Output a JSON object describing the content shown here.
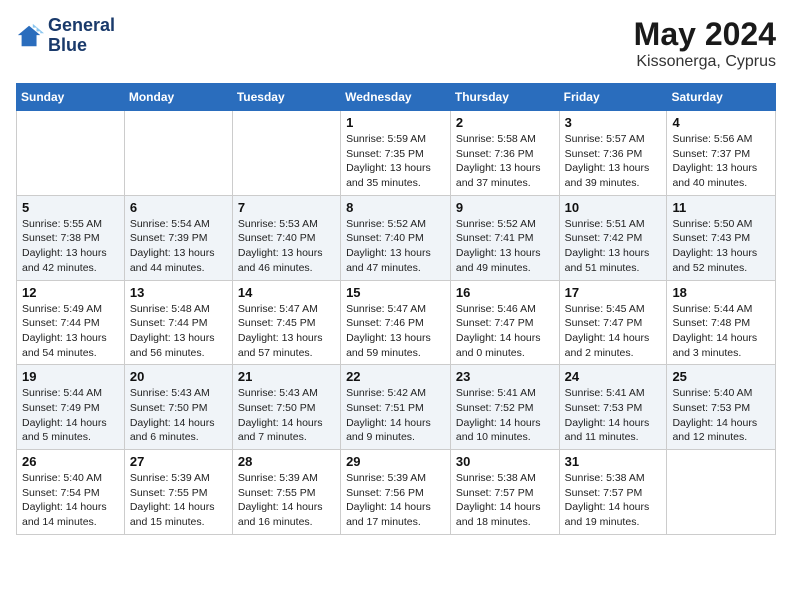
{
  "header": {
    "logo_line1": "General",
    "logo_line2": "Blue",
    "month_year": "May 2024",
    "location": "Kissonerga, Cyprus"
  },
  "weekdays": [
    "Sunday",
    "Monday",
    "Tuesday",
    "Wednesday",
    "Thursday",
    "Friday",
    "Saturday"
  ],
  "weeks": [
    [
      {
        "day": "",
        "info": ""
      },
      {
        "day": "",
        "info": ""
      },
      {
        "day": "",
        "info": ""
      },
      {
        "day": "1",
        "info": "Sunrise: 5:59 AM\nSunset: 7:35 PM\nDaylight: 13 hours\nand 35 minutes."
      },
      {
        "day": "2",
        "info": "Sunrise: 5:58 AM\nSunset: 7:36 PM\nDaylight: 13 hours\nand 37 minutes."
      },
      {
        "day": "3",
        "info": "Sunrise: 5:57 AM\nSunset: 7:36 PM\nDaylight: 13 hours\nand 39 minutes."
      },
      {
        "day": "4",
        "info": "Sunrise: 5:56 AM\nSunset: 7:37 PM\nDaylight: 13 hours\nand 40 minutes."
      }
    ],
    [
      {
        "day": "5",
        "info": "Sunrise: 5:55 AM\nSunset: 7:38 PM\nDaylight: 13 hours\nand 42 minutes."
      },
      {
        "day": "6",
        "info": "Sunrise: 5:54 AM\nSunset: 7:39 PM\nDaylight: 13 hours\nand 44 minutes."
      },
      {
        "day": "7",
        "info": "Sunrise: 5:53 AM\nSunset: 7:40 PM\nDaylight: 13 hours\nand 46 minutes."
      },
      {
        "day": "8",
        "info": "Sunrise: 5:52 AM\nSunset: 7:40 PM\nDaylight: 13 hours\nand 47 minutes."
      },
      {
        "day": "9",
        "info": "Sunrise: 5:52 AM\nSunset: 7:41 PM\nDaylight: 13 hours\nand 49 minutes."
      },
      {
        "day": "10",
        "info": "Sunrise: 5:51 AM\nSunset: 7:42 PM\nDaylight: 13 hours\nand 51 minutes."
      },
      {
        "day": "11",
        "info": "Sunrise: 5:50 AM\nSunset: 7:43 PM\nDaylight: 13 hours\nand 52 minutes."
      }
    ],
    [
      {
        "day": "12",
        "info": "Sunrise: 5:49 AM\nSunset: 7:44 PM\nDaylight: 13 hours\nand 54 minutes."
      },
      {
        "day": "13",
        "info": "Sunrise: 5:48 AM\nSunset: 7:44 PM\nDaylight: 13 hours\nand 56 minutes."
      },
      {
        "day": "14",
        "info": "Sunrise: 5:47 AM\nSunset: 7:45 PM\nDaylight: 13 hours\nand 57 minutes."
      },
      {
        "day": "15",
        "info": "Sunrise: 5:47 AM\nSunset: 7:46 PM\nDaylight: 13 hours\nand 59 minutes."
      },
      {
        "day": "16",
        "info": "Sunrise: 5:46 AM\nSunset: 7:47 PM\nDaylight: 14 hours\nand 0 minutes."
      },
      {
        "day": "17",
        "info": "Sunrise: 5:45 AM\nSunset: 7:47 PM\nDaylight: 14 hours\nand 2 minutes."
      },
      {
        "day": "18",
        "info": "Sunrise: 5:44 AM\nSunset: 7:48 PM\nDaylight: 14 hours\nand 3 minutes."
      }
    ],
    [
      {
        "day": "19",
        "info": "Sunrise: 5:44 AM\nSunset: 7:49 PM\nDaylight: 14 hours\nand 5 minutes."
      },
      {
        "day": "20",
        "info": "Sunrise: 5:43 AM\nSunset: 7:50 PM\nDaylight: 14 hours\nand 6 minutes."
      },
      {
        "day": "21",
        "info": "Sunrise: 5:43 AM\nSunset: 7:50 PM\nDaylight: 14 hours\nand 7 minutes."
      },
      {
        "day": "22",
        "info": "Sunrise: 5:42 AM\nSunset: 7:51 PM\nDaylight: 14 hours\nand 9 minutes."
      },
      {
        "day": "23",
        "info": "Sunrise: 5:41 AM\nSunset: 7:52 PM\nDaylight: 14 hours\nand 10 minutes."
      },
      {
        "day": "24",
        "info": "Sunrise: 5:41 AM\nSunset: 7:53 PM\nDaylight: 14 hours\nand 11 minutes."
      },
      {
        "day": "25",
        "info": "Sunrise: 5:40 AM\nSunset: 7:53 PM\nDaylight: 14 hours\nand 12 minutes."
      }
    ],
    [
      {
        "day": "26",
        "info": "Sunrise: 5:40 AM\nSunset: 7:54 PM\nDaylight: 14 hours\nand 14 minutes."
      },
      {
        "day": "27",
        "info": "Sunrise: 5:39 AM\nSunset: 7:55 PM\nDaylight: 14 hours\nand 15 minutes."
      },
      {
        "day": "28",
        "info": "Sunrise: 5:39 AM\nSunset: 7:55 PM\nDaylight: 14 hours\nand 16 minutes."
      },
      {
        "day": "29",
        "info": "Sunrise: 5:39 AM\nSunset: 7:56 PM\nDaylight: 14 hours\nand 17 minutes."
      },
      {
        "day": "30",
        "info": "Sunrise: 5:38 AM\nSunset: 7:57 PM\nDaylight: 14 hours\nand 18 minutes."
      },
      {
        "day": "31",
        "info": "Sunrise: 5:38 AM\nSunset: 7:57 PM\nDaylight: 14 hours\nand 19 minutes."
      },
      {
        "day": "",
        "info": ""
      }
    ]
  ]
}
